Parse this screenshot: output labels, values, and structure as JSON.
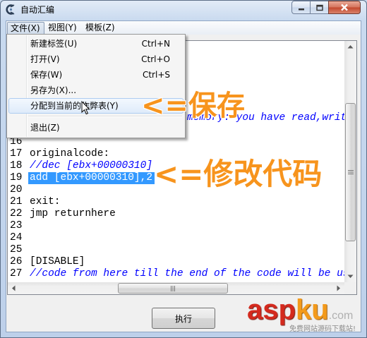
{
  "window": {
    "title": "自动汇编"
  },
  "menubar": {
    "file": "文件(X)",
    "view": "视图(Y)",
    "template": "模板(Z)"
  },
  "file_menu": {
    "items": [
      {
        "label": "新建标签(U)",
        "shortcut": "Ctrl+N"
      },
      {
        "label": "打开(V)",
        "shortcut": "Ctrl+O"
      },
      {
        "label": "保存(W)",
        "shortcut": "Ctrl+S"
      },
      {
        "label": "另存为(X)...",
        "shortcut": ""
      },
      {
        "label": "分配到当前的作弊表(Y)",
        "shortcut": ""
      },
      {
        "label": "退出(Z)",
        "shortcut": ""
      }
    ]
  },
  "editor": {
    "partial_line": {
      "text": "memory: you have read,write,",
      "comment": true
    },
    "lines": [
      {
        "num": "16",
        "text": ""
      },
      {
        "num": "17",
        "text": "originalcode:"
      },
      {
        "num": "18",
        "text": "//dec [ebx+00000310]",
        "comment": true
      },
      {
        "num": "19",
        "text": "add [ebx+00000310],2",
        "selected": true
      },
      {
        "num": "20",
        "text": ""
      },
      {
        "num": "21",
        "text": "exit:"
      },
      {
        "num": "22",
        "text": "jmp returnhere"
      },
      {
        "num": "23",
        "text": ""
      },
      {
        "num": "24",
        "text": ""
      },
      {
        "num": "25",
        "text": ""
      },
      {
        "num": "26",
        "text": "[DISABLE]"
      },
      {
        "num": "27",
        "text": "//code from here till the end of the code will be used t",
        "comment": true
      }
    ]
  },
  "execute_button": "执行",
  "annotations": {
    "save": "<=保存",
    "modify_code": "<=修改代码"
  },
  "watermark": {
    "asp": "asp",
    "ku": "ku",
    "com": ".com",
    "tagline": "免费网站源码下载站!"
  },
  "colors": {
    "comment": "#0000ff",
    "selection": "#3399ff",
    "annotation": "#f7941d",
    "close_button": "#c3472d"
  },
  "icons": {
    "app": "cheat-engine-icon",
    "cursor": "arrow-cursor-icon",
    "minimize": "minimize-icon",
    "maximize": "maximize-icon",
    "close": "close-icon"
  }
}
